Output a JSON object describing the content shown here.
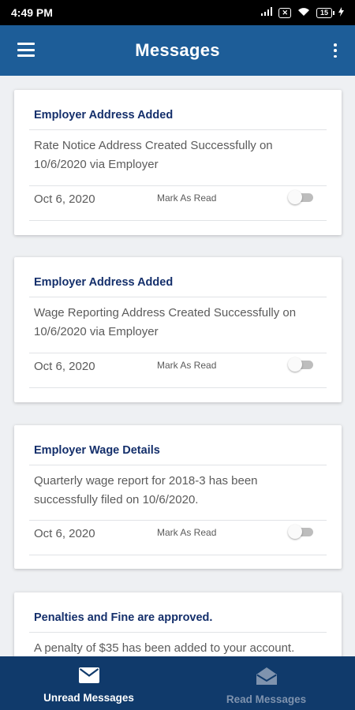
{
  "status_bar": {
    "time": "4:49 PM",
    "sim_badge": "✕",
    "battery": "15"
  },
  "app_bar": {
    "title": "Messages"
  },
  "messages": [
    {
      "title": "Employer Address Added",
      "body": "Rate Notice Address Created Successfully on 10/6/2020 via Employer",
      "date": "Oct 6, 2020",
      "mark_label": "Mark As Read",
      "read": false
    },
    {
      "title": "Employer Address Added",
      "body": "Wage Reporting Address Created Successfully on 10/6/2020 via Employer",
      "date": "Oct 6, 2020",
      "mark_label": "Mark As Read",
      "read": false
    },
    {
      "title": "Employer Wage Details",
      "body": "Quarterly wage report for 2018-3 has been successfully filed on 10/6/2020.",
      "date": "Oct 6, 2020",
      "mark_label": "Mark As Read",
      "read": false
    },
    {
      "title": "Penalties and Fine are approved.",
      "body": "A penalty of $35 has been added to your account.",
      "date": "",
      "mark_label": "",
      "read": false
    }
  ],
  "bottom_nav": {
    "unread_label": "Unread Messages",
    "read_label": "Read Messages",
    "active_color": "#ffffff",
    "inactive_color": "#7f93ae"
  },
  "colors": {
    "app_bar": "#1d5d98",
    "bottom_nav": "#103a6b",
    "title_text": "#142f6b"
  }
}
